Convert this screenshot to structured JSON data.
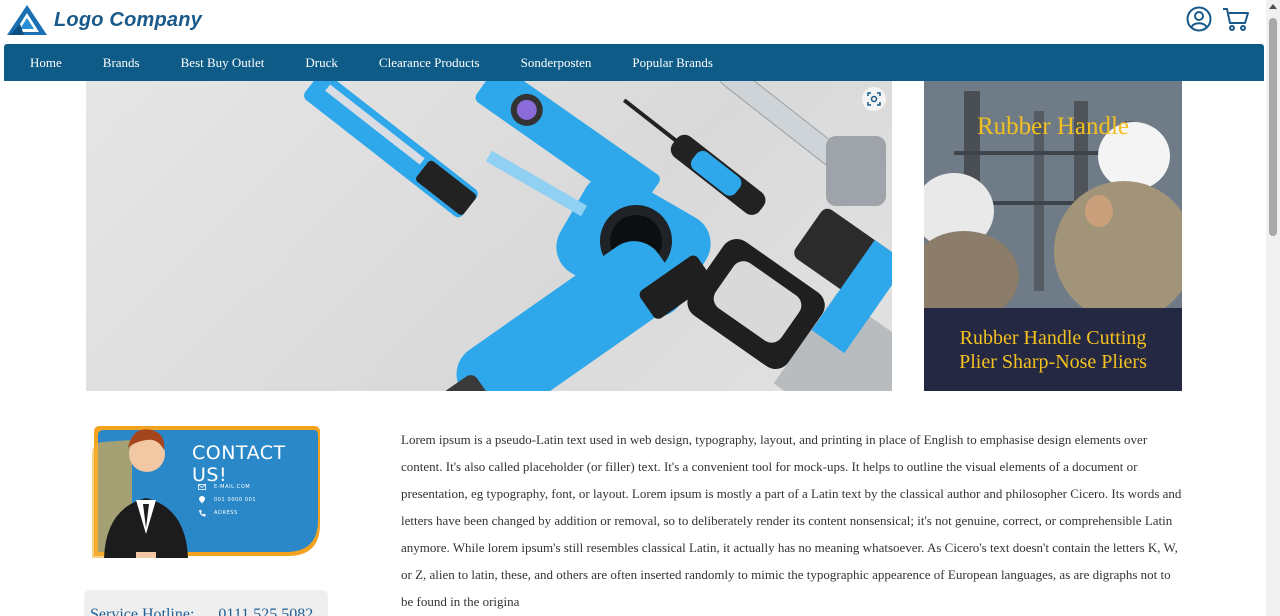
{
  "brand": {
    "name": "Logo Company",
    "color": "#1a5a8a",
    "icon": "triangle-logo-icon"
  },
  "header": {
    "account_icon": "user-circle-icon",
    "cart_icon": "cart-icon"
  },
  "nav": {
    "color": "#0d5b86",
    "items": [
      {
        "label": "Home"
      },
      {
        "label": "Brands"
      },
      {
        "label": "Best Buy Outlet"
      },
      {
        "label": "Druck"
      },
      {
        "label": "Clearance Products"
      },
      {
        "label": "Sonderposten"
      },
      {
        "label": "Popular Brands"
      }
    ]
  },
  "hero": {
    "zoom_icon": "zoom-scan-icon",
    "image": "tools-flatlay-image"
  },
  "side_banner": {
    "title": "Rubber Handle",
    "caption_line1": "Rubber Handle Cutting",
    "caption_line2": "Plier Sharp-Nose Pliers",
    "accent": "#f2c020"
  },
  "contact": {
    "heading": "CONTACT US!",
    "email": "E-MAIL.COM",
    "phone": "001 0000 001",
    "address": "ADRESS"
  },
  "hotline": {
    "label": "Service Hotline:",
    "number": "0111 525 5082"
  },
  "content": {
    "paragraph": "Lorem ipsum is a pseudo-Latin text used in web design, typography, layout, and printing in place of English to emphasise design elements over content. It's also called placeholder (or filler) text. It's a convenient tool for mock-ups. It helps to outline the visual elements of a document or presentation, eg typography, font, or layout. Lorem ipsum is mostly a part of a Latin text by the classical author and philosopher Cicero. Its words and letters have been changed by addition or removal, so to deliberately render its content nonsensical; it's not genuine, correct, or comprehensible Latin anymore. While lorem ipsum's still resembles classical Latin, it actually has no meaning whatsoever. As Cicero's text doesn't contain the letters K, W, or Z, alien to latin, these, and others are often inserted randomly to mimic the typographic appearence of European languages, as are digraphs not to be found in the origina"
  }
}
